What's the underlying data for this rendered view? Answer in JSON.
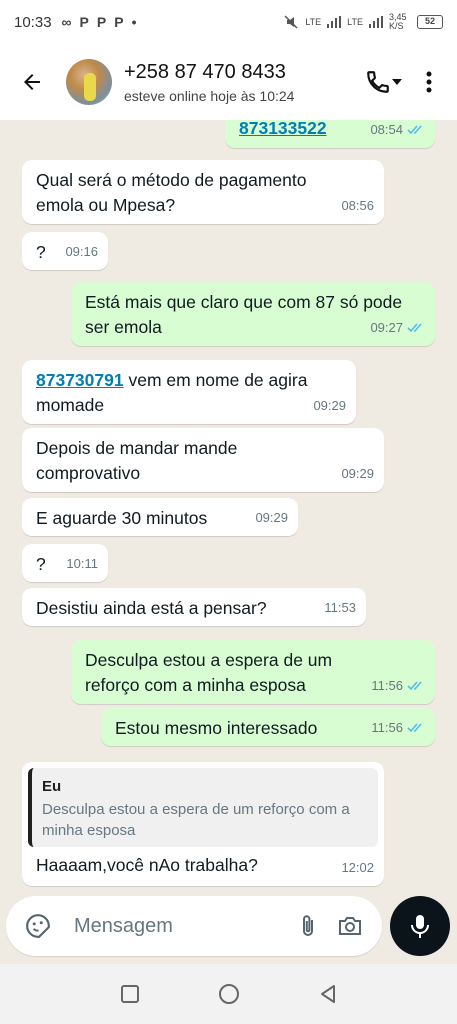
{
  "status_bar": {
    "time": "10:33",
    "apps": [
      "∞",
      "P",
      "P",
      "P",
      "•"
    ],
    "network": "LTE",
    "speed": "3,45 K/S",
    "battery": "52"
  },
  "header": {
    "contact_name": "+258 87 470 8433",
    "last_seen": "esteve online hoje às 10:24"
  },
  "messages": [
    {
      "dir": "out",
      "link": "873133522",
      "text": "",
      "time": "08:54",
      "read": true
    },
    {
      "dir": "in",
      "text": "Qual será o método de pagamento emola ou Mpesa?",
      "time": "08:56"
    },
    {
      "dir": "in",
      "text": "?",
      "time": "09:16"
    },
    {
      "dir": "out",
      "text": "Está mais que claro que com 87 só pode ser emola",
      "time": "09:27",
      "read": true
    },
    {
      "dir": "in",
      "link": "873730791",
      "text": " vem em nome de agira momade",
      "time": "09:29"
    },
    {
      "dir": "in",
      "text": "Depois de mandar mande comprovativo",
      "time": "09:29"
    },
    {
      "dir": "in",
      "text": "E aguarde 30 minutos",
      "time": "09:29"
    },
    {
      "dir": "in",
      "text": "?",
      "time": "10:11"
    },
    {
      "dir": "in",
      "text": "Desistiu ainda está a pensar?",
      "time": "11:53"
    },
    {
      "dir": "out",
      "text": "Desculpa estou a espera de um reforço com a minha esposa",
      "time": "11:56",
      "read": true
    },
    {
      "dir": "out",
      "text": "Estou mesmo interessado",
      "time": "11:56",
      "read": true
    },
    {
      "dir": "in",
      "quote_name": "Eu",
      "quote_text": "Desculpa estou a espera de um reforço com a minha esposa",
      "text": "Haaaam,você nAo trabalha?",
      "time": "12:02"
    }
  ],
  "input": {
    "placeholder": "Mensagem"
  },
  "colors": {
    "outgoing": "#d9fdd3",
    "incoming": "#ffffff",
    "tick": "#53bdeb",
    "link": "#027eb5",
    "background": "#efeae2"
  }
}
